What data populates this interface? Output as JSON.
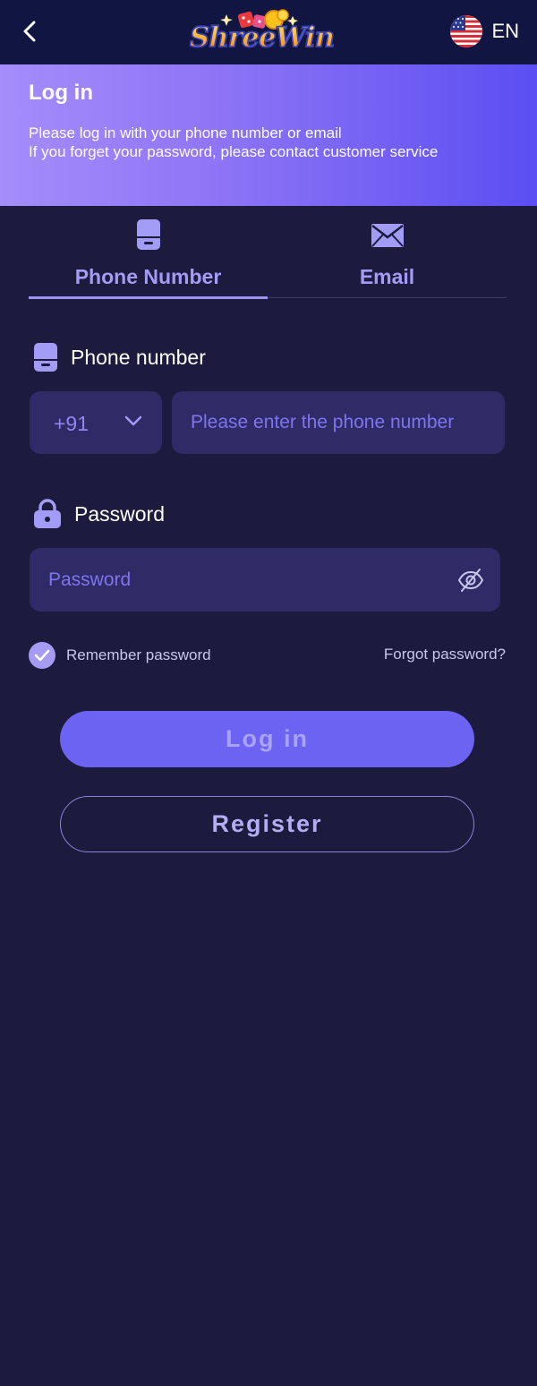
{
  "header": {
    "logo_text": "ShreeWin",
    "language": "EN"
  },
  "banner": {
    "title": "Log in",
    "line1": "Please log in with your phone number or email",
    "line2": "If you forget your password, please contact customer service"
  },
  "tabs": [
    {
      "label": "Phone Number",
      "icon": "phone-icon",
      "active": true
    },
    {
      "label": "Email",
      "icon": "email-icon",
      "active": false
    }
  ],
  "phone_field": {
    "label": "Phone number",
    "country_code": "+91",
    "placeholder": "Please enter the phone number"
  },
  "password_field": {
    "label": "Password",
    "placeholder": "Password"
  },
  "remember_label": "Remember password",
  "forgot_label": "Forgot password?",
  "login_label": "Log in",
  "register_label": "Register",
  "colors": {
    "background": "#1c1b3e",
    "topbar": "#111541",
    "accent": "#6c63f2",
    "input_bg": "#2f2b66"
  }
}
